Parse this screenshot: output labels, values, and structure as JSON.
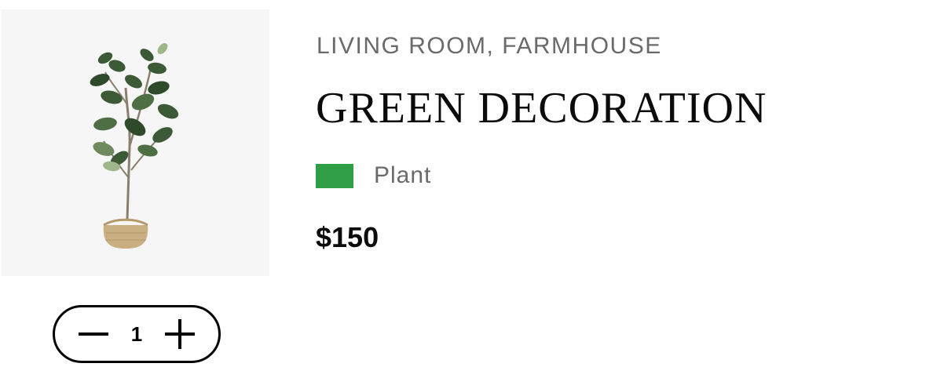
{
  "product": {
    "image_alt": "fiddle leaf fig plant in woven basket",
    "categories": "LIVING ROOM, FARMHOUSE",
    "title": "GREEN DECORATION",
    "color_name": "Plant",
    "color_hex": "#2f9e44",
    "price": "$150"
  },
  "quantity": {
    "value": "1",
    "decrement_icon": "minus-icon",
    "increment_icon": "plus-icon"
  }
}
